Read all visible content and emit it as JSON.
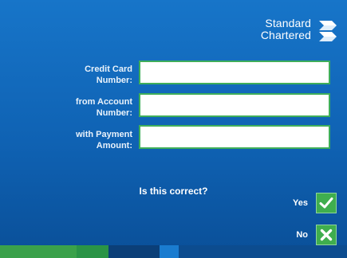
{
  "brand": {
    "name_line1": "Standard",
    "name_line2": "Chartered",
    "logo_icon": "standard-chartered-logo"
  },
  "form": {
    "credit_card": {
      "label_line1": "Credit Card",
      "label_line2": "Number:",
      "value": ""
    },
    "from_account": {
      "label_line1": "from Account",
      "label_line2": "Number:",
      "value": ""
    },
    "payment_amount": {
      "label_line1": "with Payment",
      "label_line2": "Amount:",
      "value": ""
    }
  },
  "confirm": {
    "question": "Is this correct?",
    "yes_label": "Yes",
    "yes_icon": "checkmark-icon",
    "no_label": "No",
    "no_icon": "cross-icon"
  },
  "colors": {
    "background": "#1470c4",
    "accent_green": "#3fae4e",
    "bottom_bar": [
      "#3aa14a",
      "#2a9446",
      "#0b3f78",
      "#0e4e94",
      "#1a7cd0",
      "#0c4c8f"
    ]
  }
}
